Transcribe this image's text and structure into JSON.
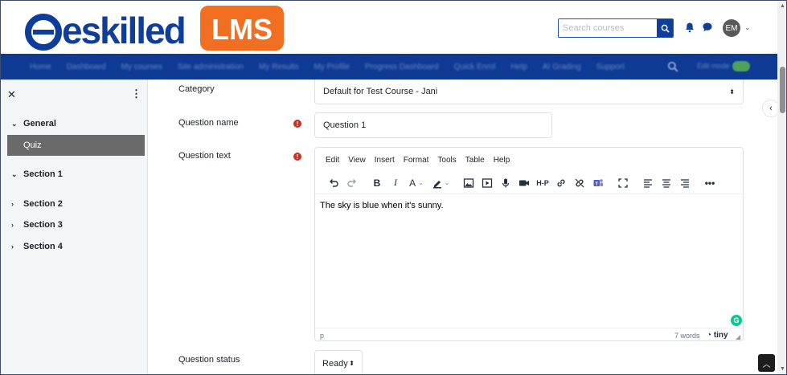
{
  "brand": {
    "logo_text": "eskilled",
    "badge_text": "LMS",
    "primary": "#0f3e9a",
    "accent": "#f26f21"
  },
  "header": {
    "search_placeholder": "Search courses",
    "icons": [
      "search-icon",
      "bell-icon",
      "chat-icon"
    ],
    "avatar_initials": "EM"
  },
  "nav": {
    "items": [
      "Home",
      "Dashboard",
      "My courses",
      "Site administration",
      "My Results",
      "My Profile",
      "Progress Dashboard",
      "Quick Enrol",
      "Help",
      "AI Grading",
      "Support"
    ],
    "edit_mode_label": "Edit mode"
  },
  "sidebar": {
    "sections": [
      {
        "label": "General",
        "expanded": true
      },
      {
        "label": "Section 1",
        "expanded": true
      },
      {
        "label": "Section 2",
        "expanded": false
      },
      {
        "label": "Section 3",
        "expanded": false
      },
      {
        "label": "Section 4",
        "expanded": false
      }
    ],
    "active_item": "Quiz"
  },
  "form": {
    "category_label": "Category",
    "category_value": "Default for Test Course - Jani",
    "question_name_label": "Question name",
    "question_name_value": "Question 1",
    "question_text_label": "Question text",
    "question_status_label": "Question status",
    "question_status_value": "Ready"
  },
  "editor": {
    "menu": [
      "Edit",
      "View",
      "Insert",
      "Format",
      "Tools",
      "Table",
      "Help"
    ],
    "content": "The sky is blue when it's sunny.",
    "status_path": "p",
    "word_count": "7 words",
    "brand": "tiny"
  }
}
